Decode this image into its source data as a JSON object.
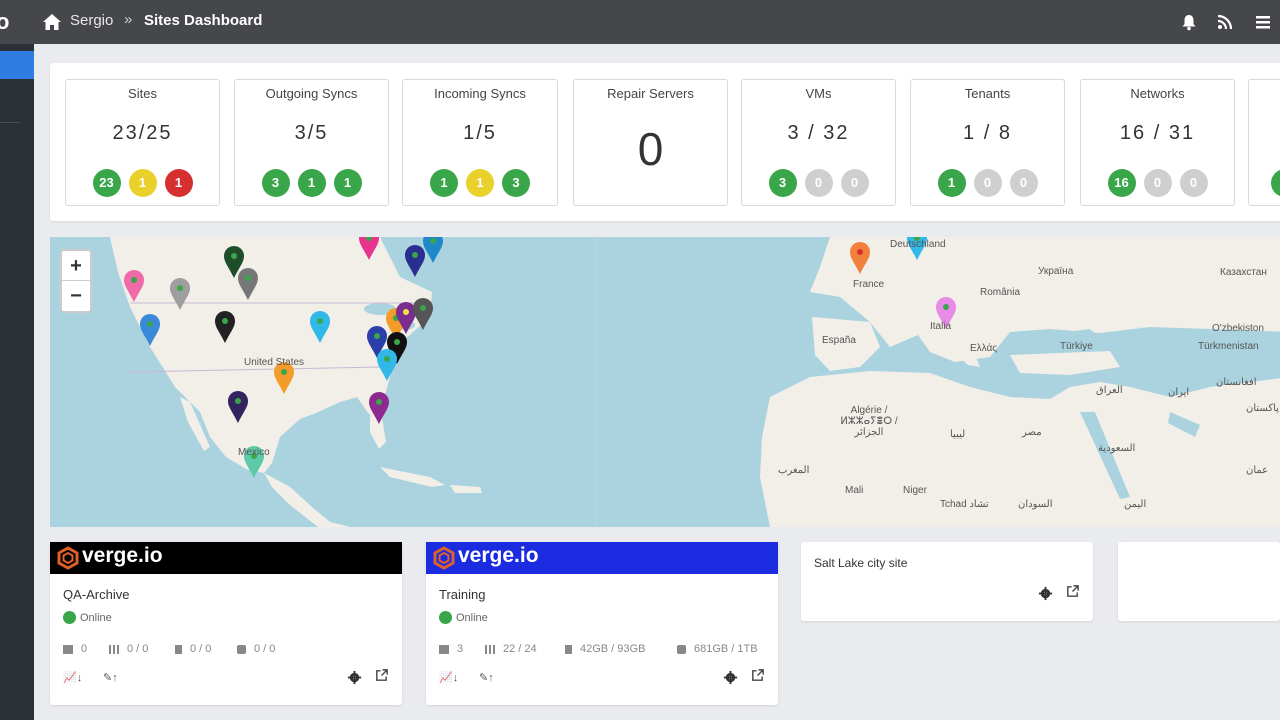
{
  "app": {
    "logo_fragment": "o"
  },
  "breadcrumb": {
    "user": "Sergio",
    "separator": "»",
    "page": "Sites Dashboard"
  },
  "colors": {
    "ok": "#3aa64a",
    "warn": "#ead02a",
    "error": "#d62f2f",
    "inactive": "#cfcfcf",
    "accent": "#2f7de1",
    "map_water": "#aad3df",
    "map_land": "#f2efe9"
  },
  "stats": [
    {
      "title": "Sites",
      "value": "23/25",
      "badges": [
        {
          "label": "23",
          "color": "green"
        },
        {
          "label": "1",
          "color": "yellow"
        },
        {
          "label": "1",
          "color": "red"
        }
      ]
    },
    {
      "title": "Outgoing Syncs",
      "value": "3/5",
      "badges": [
        {
          "label": "3",
          "color": "green"
        },
        {
          "label": "1",
          "color": "green"
        },
        {
          "label": "1",
          "color": "green"
        }
      ]
    },
    {
      "title": "Incoming Syncs",
      "value": "1/5",
      "badges": [
        {
          "label": "1",
          "color": "green"
        },
        {
          "label": "1",
          "color": "yellow"
        },
        {
          "label": "3",
          "color": "green"
        }
      ]
    },
    {
      "title": "Repair Servers",
      "value": "0",
      "badges": []
    },
    {
      "title": "VMs",
      "value": "3 / 32",
      "badges": [
        {
          "label": "3",
          "color": "green"
        },
        {
          "label": "0",
          "color": "gray"
        },
        {
          "label": "0",
          "color": "gray"
        }
      ]
    },
    {
      "title": "Tenants",
      "value": "1 / 8",
      "badges": [
        {
          "label": "1",
          "color": "green"
        },
        {
          "label": "0",
          "color": "gray"
        },
        {
          "label": "0",
          "color": "gray"
        }
      ]
    },
    {
      "title": "Networks",
      "value": "16 / 31",
      "badges": [
        {
          "label": "16",
          "color": "green"
        },
        {
          "label": "0",
          "color": "gray"
        },
        {
          "label": "0",
          "color": "gray"
        }
      ]
    }
  ],
  "map": {
    "zoom_in": "+",
    "zoom_out": "−",
    "labels": [
      "United States",
      "Mexico",
      "France",
      "España",
      "Deutschland",
      "Italia",
      "Україна",
      "România",
      "Ελλάς",
      "Türkiye",
      "Казахстан",
      "O'zbekiston",
      "Türkmenistan",
      "العراق",
      "ایران",
      "افغانستان",
      "پاکستان",
      "السعودية",
      "Algérie / ⵍⵣⵣⴰⵢⴻⵔ / الجزائر",
      "ليبيا",
      "مصر",
      "المغرب",
      "Mali",
      "Niger",
      "Tchad تشاد",
      "السودان",
      "اليمن",
      "عمان"
    ]
  },
  "sites": [
    {
      "brand": "verge.io",
      "name": "QA-Archive",
      "status": "Online",
      "metrics": [
        "0",
        "0 / 0",
        "0 / 0",
        "0 / 0"
      ],
      "header_color": "#000000"
    },
    {
      "brand": "verge.io",
      "name": "Training",
      "status": "Online",
      "metrics": [
        "3",
        "22 / 24",
        "42GB / 93GB",
        "681GB / 1TB"
      ],
      "header_color": "#1a2be0"
    },
    {
      "name": "Salt Lake city site"
    }
  ],
  "icons": {
    "home": "home-icon",
    "bell": "bell-icon",
    "rss": "rss-icon",
    "menu": "menu-icon",
    "settings": "gear-icon",
    "open": "external-link-icon"
  }
}
